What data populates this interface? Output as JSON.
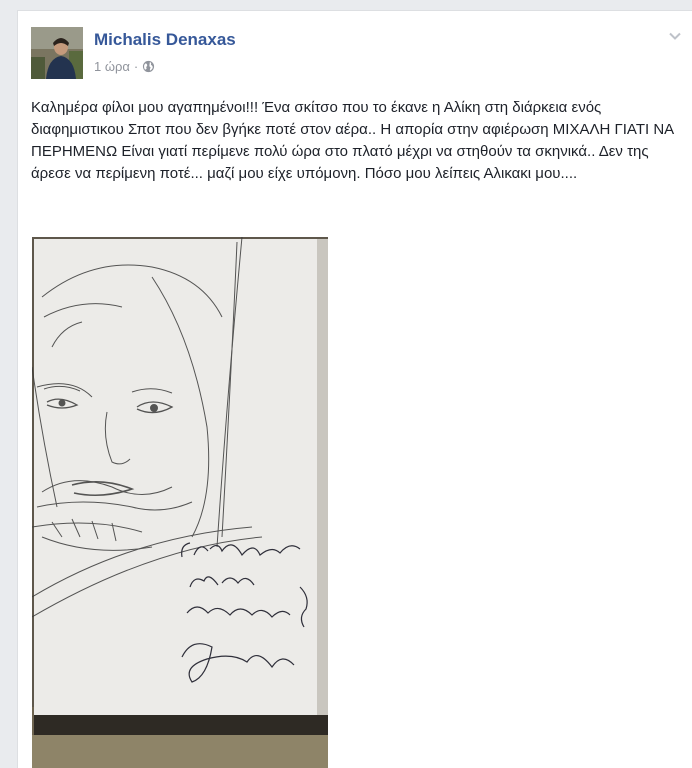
{
  "post": {
    "author": "Michalis Denaxas",
    "time": "1 ώρα",
    "separator": "·",
    "privacy_icon": "globe-icon",
    "options_icon": "chevron-down-icon",
    "text": "Καλημέρα φίλοι μου αγαπημένοι!!! Ένα σκίτσο που το έκανε η Αλίκη στη διάρκεια ενός διαφημιστικου Σποτ που δεν βγήκε ποτέ στον αέρα.. Η απορία στην αφιέρωση ΜΙΧΑΛΗ ΓΙΑΤΙ ΝΑ ΠΕΡΗΜΕΝΩ Είναι γιατί περίμενε πολύ ώρα στο πλατό μέχρι να στηθούν τα σκηνικά.. Δεν της άρεσε να περίμενη ποτέ... μαζί μου είχε υπόμονη. Πόσο μου λείπεις Αλικακι μου....",
    "photo_handwritten_text": "Στο Μιχάλη Γιατί να περιμένω?"
  },
  "colors": {
    "page_background": "#e9ebee",
    "card_background": "#ffffff",
    "author_link": "#365899",
    "meta_text": "#90949c",
    "body_text": "#1d2129"
  }
}
